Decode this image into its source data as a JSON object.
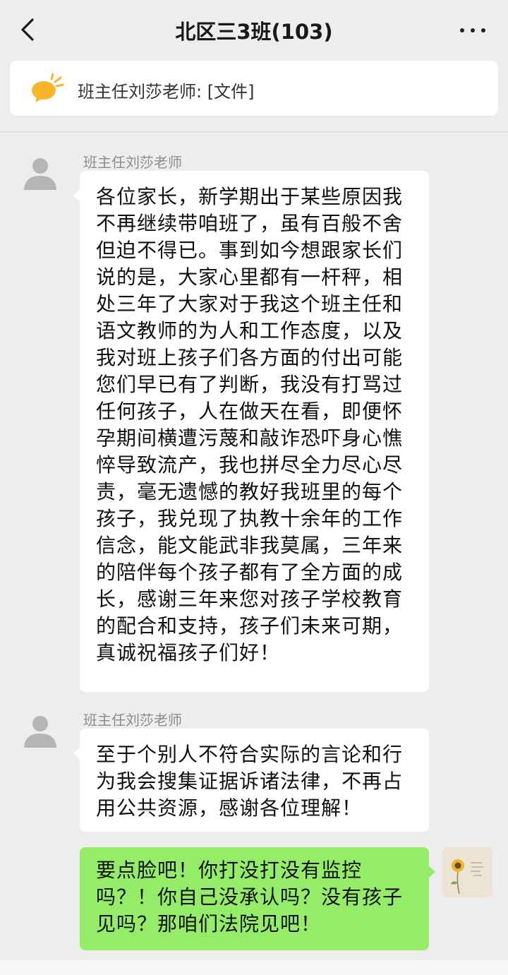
{
  "header": {
    "title": "北区三3班(103)",
    "back_icon": "chevron-left-icon",
    "more_icon": "more-dots-icon"
  },
  "notice": {
    "icon": "announcement-speaker-icon",
    "text": "班主任刘莎老师: [文件]"
  },
  "messages": [
    {
      "side": "left",
      "sender": "班主任刘莎老师",
      "avatar": "default-avatar-icon",
      "lines": [
        "各位家长，新学期出于某些原因我",
        "不再继续带咱班了，虽有百般不舍",
        "但迫不得已。事到如今想跟家长们",
        "说的是，大家心里都有一杆秤，相",
        "处三年了大家对于我这个班主任和",
        "语文教师的为人和工作态度，以及",
        "我对班上孩子们各方面的付出可能",
        "您们早已有了判断，我没有打骂过",
        "任何孩子，人在做天在看，即便怀",
        "孕期间横遭污蔑和敲诈恐吓身心憔",
        "悴导致流产，我也拼尽全力尽心尽",
        "责，毫无遗憾的教好我班里的每个",
        "孩子，我兑现了执教十余年的工作",
        "信念，能文能武非我莫属，三年来",
        "的陪伴每个孩子都有了全方面的成",
        "长，感谢三年来您对孩子学校教育",
        "的配合和支持，孩子们未来可期，",
        "真诚祝福孩子们好！"
      ]
    },
    {
      "side": "left",
      "sender": "班主任刘莎老师",
      "avatar": "default-avatar-icon",
      "lines": [
        "至于个别人不符合实际的言论和行",
        "为我会搜集证据诉诸法律，不再占",
        "用公共资源，感谢各位理解！"
      ]
    },
    {
      "side": "right",
      "avatar": "sunflower-avatar",
      "lines": [
        "要点脸吧！你打没打没有监控",
        "吗？！你自己没承认吗？没有孩子",
        "见吗？那咱们法院见吧！"
      ]
    }
  ],
  "colors": {
    "background": "#ededed",
    "bubble_self": "#95ec69",
    "bubble_other": "#ffffff",
    "sender_name": "#8d8d8d"
  }
}
